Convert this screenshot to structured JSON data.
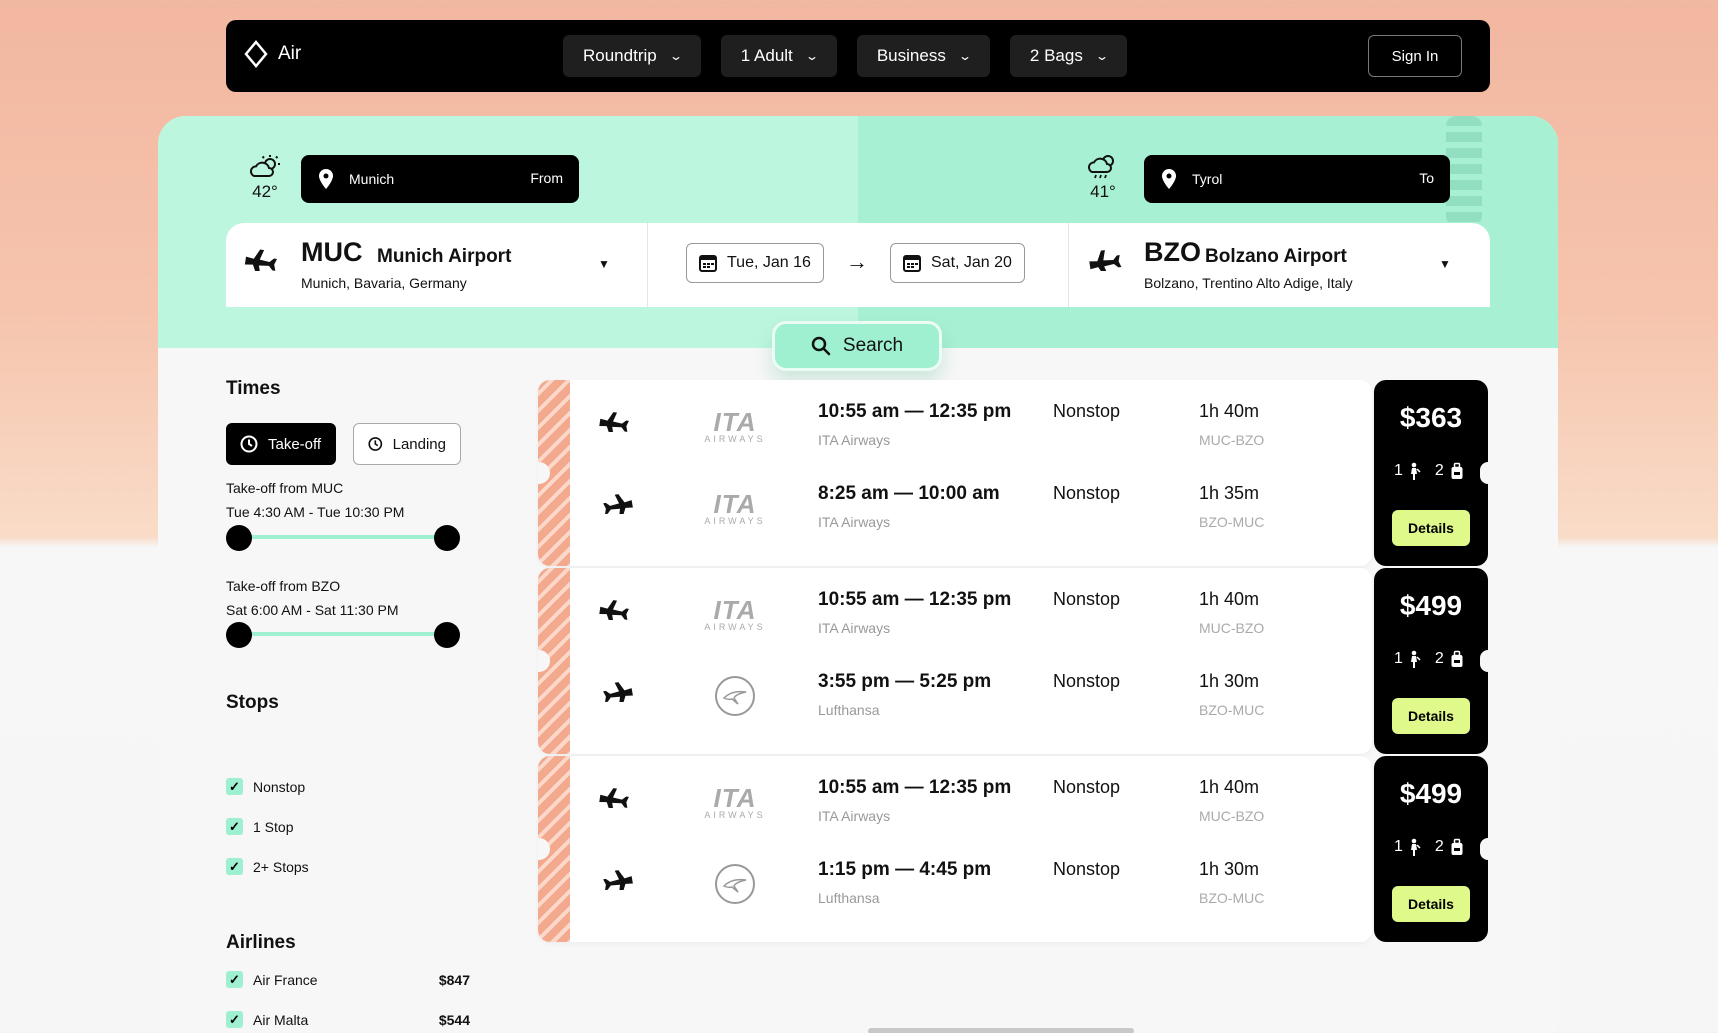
{
  "app": {
    "title": "Air"
  },
  "nav": {
    "trip_type": "Roundtrip",
    "passengers": "1 Adult",
    "cabin": "Business",
    "bags": "2 Bags",
    "sign_in": "Sign In"
  },
  "origin": {
    "temp": "42°",
    "place": "Munich",
    "place_label": "From",
    "code": "MUC",
    "airport": "Munich Airport",
    "location": "Munich, Bavaria, Germany"
  },
  "destination": {
    "temp": "41°",
    "place": "Tyrol",
    "place_label": "To",
    "code": "BZO",
    "airport": "Bolzano Airport",
    "location": "Bolzano, Trentino Alto Adige, Italy"
  },
  "dates": {
    "depart": "Tue, Jan 16",
    "return": "Sat, Jan 20"
  },
  "search": {
    "label": "Search"
  },
  "filters": {
    "times_title": "Times",
    "takeoff_btn": "Take-off",
    "landing_btn": "Landing",
    "range1_title": "Take-off from MUC",
    "range1_value": "Tue 4:30 AM - Tue 10:30 PM",
    "range2_title": "Take-off from BZO",
    "range2_value": "Sat 6:00 AM - Sat 11:30 PM",
    "stops_title": "Stops",
    "stops": [
      "Nonstop",
      "1 Stop",
      "2+ Stops"
    ],
    "airlines_title": "Airlines",
    "airlines": [
      {
        "name": "Air France",
        "price": "$847"
      },
      {
        "name": "Air Malta",
        "price": "$544"
      }
    ]
  },
  "results": [
    {
      "price": "$363",
      "adults": "1",
      "bags": "2",
      "details": "Details",
      "legs": [
        {
          "logo": "ita",
          "times": "10:55 am — 12:35 pm",
          "airline": "ITA Airways",
          "stops": "Nonstop",
          "duration": "1h 40m",
          "route": "MUC-BZO"
        },
        {
          "logo": "ita",
          "times": "8:25 am — 10:00 am",
          "airline": "ITA Airways",
          "stops": "Nonstop",
          "duration": "1h 35m",
          "route": "BZO-MUC"
        }
      ]
    },
    {
      "price": "$499",
      "adults": "1",
      "bags": "2",
      "details": "Details",
      "legs": [
        {
          "logo": "ita",
          "times": "10:55 am — 12:35 pm",
          "airline": "ITA Airways",
          "stops": "Nonstop",
          "duration": "1h 40m",
          "route": "MUC-BZO"
        },
        {
          "logo": "lufthansa",
          "times": "3:55 pm — 5:25 pm",
          "airline": "Lufthansa",
          "stops": "Nonstop",
          "duration": "1h 30m",
          "route": "BZO-MUC"
        }
      ]
    },
    {
      "price": "$499",
      "adults": "1",
      "bags": "2",
      "details": "Details",
      "legs": [
        {
          "logo": "ita",
          "times": "10:55 am — 12:35 pm",
          "airline": "ITA Airways",
          "stops": "Nonstop",
          "duration": "1h 40m",
          "route": "MUC-BZO"
        },
        {
          "logo": "lufthansa",
          "times": "1:15 pm — 4:45 pm",
          "airline": "Lufthansa",
          "stops": "Nonstop",
          "duration": "1h 30m",
          "route": "BZO-MUC"
        }
      ]
    }
  ],
  "logos": {
    "ita_big": "ITA",
    "ita_small": "AIRWAYS"
  },
  "colors": {
    "accent_mint": "#9ef0d0",
    "details_lime": "#dff98a",
    "stripe_peach": "#f2a98d"
  }
}
